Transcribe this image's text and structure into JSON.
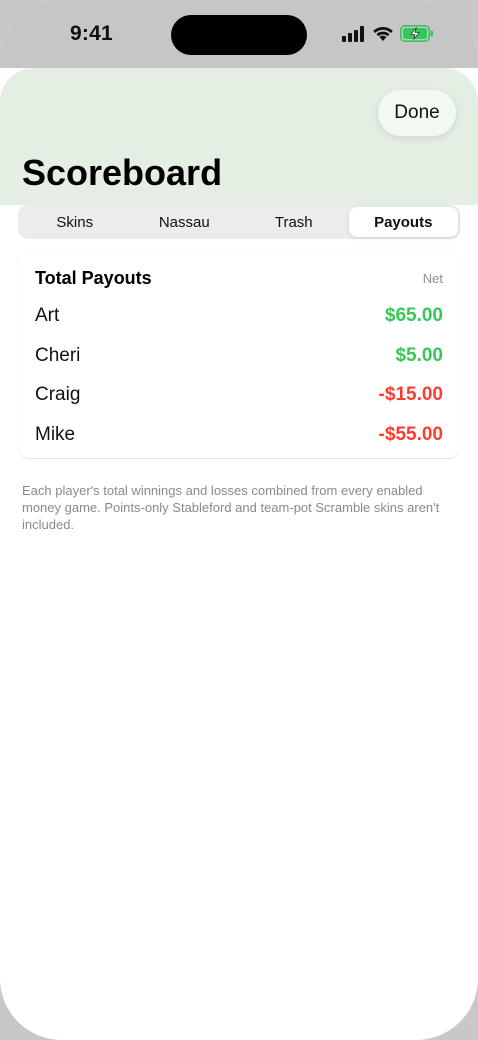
{
  "status_bar": {
    "time": "9:41",
    "icons": [
      "cellular-signal-icon",
      "wifi-icon",
      "battery-charging-icon"
    ]
  },
  "header": {
    "done_label": "Done",
    "title": "Scoreboard"
  },
  "tabs": [
    {
      "label": "Skins",
      "selected": false
    },
    {
      "label": "Nassau",
      "selected": false
    },
    {
      "label": "Trash",
      "selected": false
    },
    {
      "label": "Payouts",
      "selected": true
    }
  ],
  "payouts": {
    "title": "Total Payouts",
    "column_label": "Net",
    "rows": [
      {
        "name": "Art",
        "amount": "$65.00"
      },
      {
        "name": "Cheri",
        "amount": "$5.00"
      },
      {
        "name": "Craig",
        "amount": "-$15.00"
      },
      {
        "name": "Mike",
        "amount": "-$55.00"
      }
    ]
  },
  "footnote": "Each player's total winnings and losses combined from every enabled money game. Points-only Stableford and team-pot Scramble skins aren't included.",
  "colors": {
    "header_bg": "#e3efe3",
    "positive": "#34c759",
    "negative": "#ff3b30",
    "battery": "#34c759"
  }
}
